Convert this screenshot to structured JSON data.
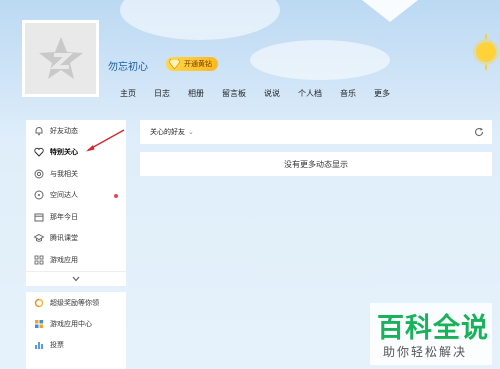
{
  "profile": {
    "username": "勿忘初心",
    "vip_label": "开通黄钻"
  },
  "nav": [
    "主页",
    "日志",
    "相册",
    "留言板",
    "说说",
    "个人档",
    "音乐",
    "更多"
  ],
  "sidebar": {
    "items": [
      {
        "label": "好友动态",
        "icon": "bell-icon"
      },
      {
        "label": "特别关心",
        "icon": "heart-icon",
        "active": true
      },
      {
        "label": "与我相关",
        "icon": "at-icon"
      },
      {
        "label": "空间达人",
        "icon": "star-circle-icon",
        "dot": true
      },
      {
        "label": "那年今日",
        "icon": "calendar-icon"
      },
      {
        "label": "腾讯课堂",
        "icon": "graduation-icon"
      },
      {
        "label": "游戏应用",
        "icon": "grid-icon"
      }
    ]
  },
  "sidebar2": {
    "items": [
      {
        "label": "超级奖励等你领",
        "icon": "gift-icon"
      },
      {
        "label": "游戏应用中心",
        "icon": "apps-icon"
      },
      {
        "label": "投票",
        "icon": "vote-icon"
      }
    ]
  },
  "feed": {
    "filter_label": "关心的好友",
    "empty_text": "没有更多动态显示"
  },
  "watermark": {
    "title": "百科全说",
    "subtitle": "助你轻松解决"
  },
  "colors": {
    "accent_blue": "#1a5ea6",
    "vip_gold": "#ffc52a",
    "watermark_green": "#18b25b",
    "arrow_red": "#d7262e"
  }
}
